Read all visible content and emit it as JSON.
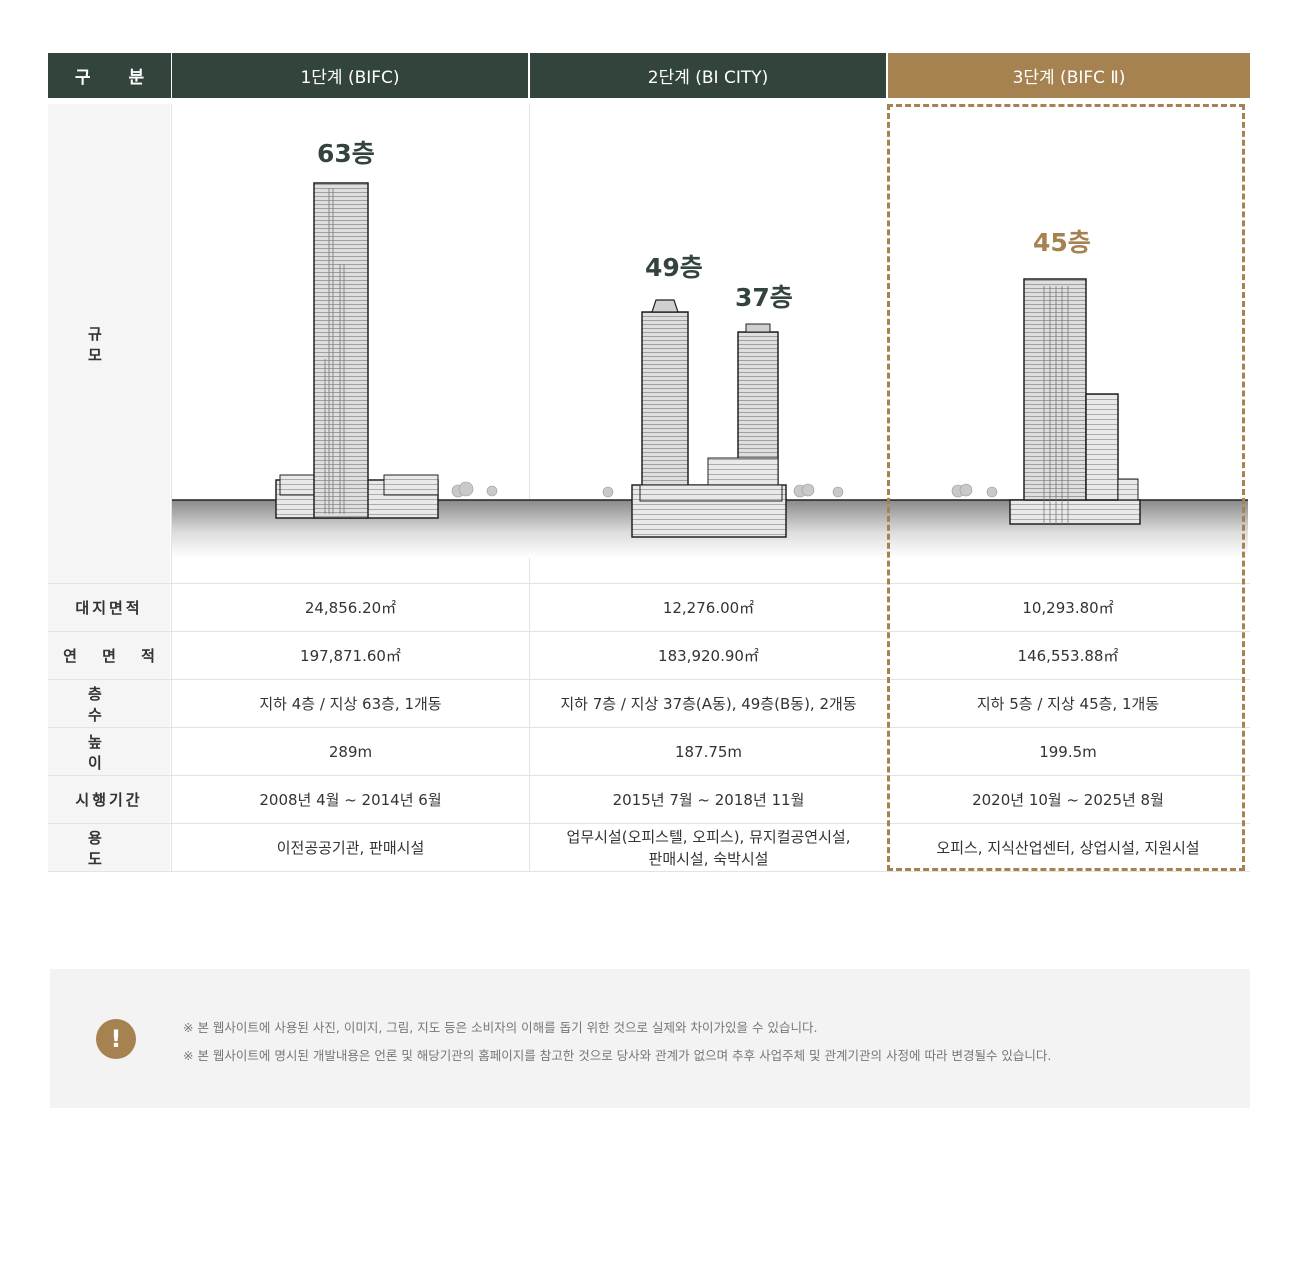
{
  "header": {
    "category": "구 분",
    "phases": [
      "1단계 (BIFC)",
      "2단계 (BI CITY)",
      "3단계 (BIFC Ⅱ)"
    ]
  },
  "scale_row": {
    "label": "규 모",
    "floor_labels": [
      "63층",
      "49층",
      "37층",
      "45층"
    ]
  },
  "rows": [
    {
      "label": "대지면적",
      "values": [
        "24,856.20㎡",
        "12,276.00㎡",
        "10,293.80㎡"
      ]
    },
    {
      "label": "연 면 적",
      "values": [
        "197,871.60㎡",
        "183,920.90㎡",
        "146,553.88㎡"
      ]
    },
    {
      "label": "층 수",
      "values": [
        "지하 4층 / 지상 63층, 1개동",
        "지하 7층 / 지상 37층(A동), 49층(B동), 2개동",
        "지하 5층 / 지상 45층, 1개동"
      ]
    },
    {
      "label": "높 이",
      "values": [
        "289m",
        "187.75m",
        "199.5m"
      ]
    },
    {
      "label": "시행기간",
      "values": [
        "2008년 4월 ~ 2014년 6월",
        "2015년 7월 ~ 2018년 11월",
        "2020년 10월 ~ 2025년 8월"
      ]
    },
    {
      "label": "용 도",
      "values": [
        "이전공공기관, 판매시설",
        "업무시설(오피스텔, 오피스), 뮤지컬공연시설,",
        "오피스, 지식산업센터, 상업시설, 지원시설"
      ],
      "extra_line": "판매시설, 숙박시설"
    }
  ],
  "notice": {
    "icon": "exclamation-icon",
    "lines": [
      "※ 본 웹사이트에 사용된 사진, 이미지, 그림, 지도 등은 소비자의 이해를 돕기 위한 것으로 실제와 차이가있을 수 있습니다.",
      "※ 본 웹사이트에 명시된 개발내용은 언론 및 해당기관의 홈페이지를 참고한 것으로 당사와 관계가 없으며 추후 사업주체 및 관계기관의 사정에 따라 변경될수 있습니다."
    ]
  },
  "colors": {
    "header_dark": "#33443c",
    "accent_gold": "#a5824f",
    "label_bg": "#f5f5f5"
  }
}
